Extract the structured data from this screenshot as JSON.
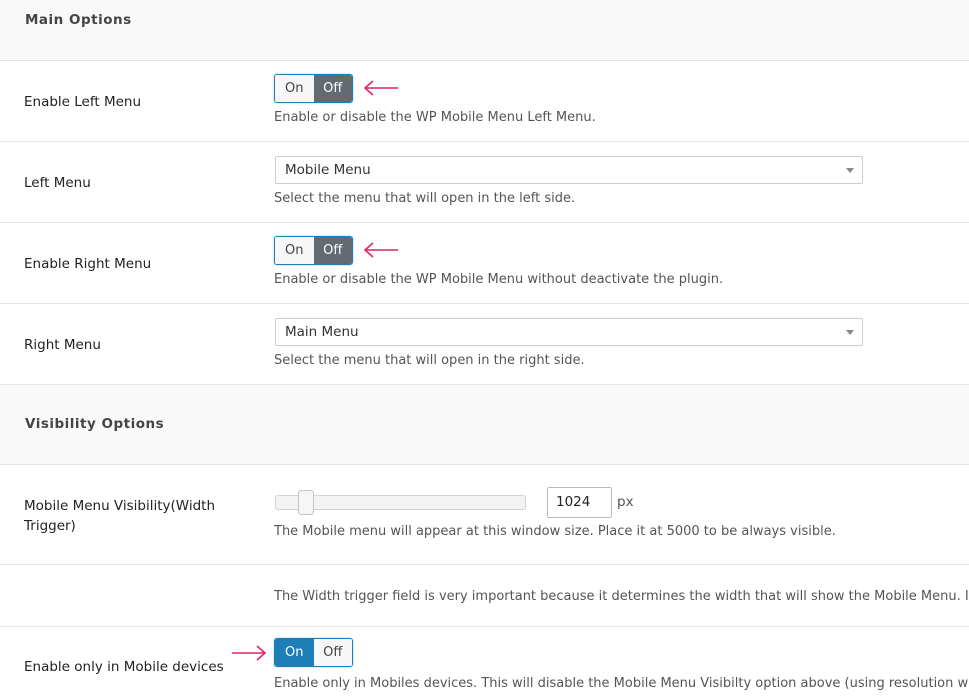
{
  "colors": {
    "accent": "#1e7fb8",
    "off_active": "#636a72",
    "arrow": "#e0245e",
    "section_bg": "#f9f9f9"
  },
  "sections": {
    "main": "Main Options",
    "visibility": "Visibility Options"
  },
  "enable_left": {
    "label": "Enable Left Menu",
    "on": "On",
    "off": "Off",
    "state": "off",
    "desc": "Enable or disable the WP Mobile Menu Left Menu."
  },
  "left_menu": {
    "label": "Left Menu",
    "value": "Mobile Menu",
    "desc": "Select the menu that will open in the left side."
  },
  "enable_right": {
    "label": "Enable Right Menu",
    "on": "On",
    "off": "Off",
    "state": "off",
    "desc": "Enable or disable the WP Mobile Menu without deactivate the plugin."
  },
  "right_menu": {
    "label": "Right Menu",
    "value": "Main Menu",
    "desc": "Select the menu that will open in the right side."
  },
  "visibility_width": {
    "label_line1": "Mobile Menu Visibility(Width",
    "label_line2": "Trigger)",
    "value": "1024",
    "unit": "px",
    "desc": "The Mobile menu will appear at this window size. Place it at 5000 to be always visible."
  },
  "width_note": {
    "text": "The Width trigger field is very important because it determines the width that will show the Mobile Menu. If you w"
  },
  "mobile_only": {
    "label": "Enable only in Mobile devices",
    "on": "On",
    "off": "Off",
    "state": "on",
    "desc": "Enable only in Mobiles devices. This will disable the Mobile Menu Visibilty option above (using resolution width t"
  }
}
